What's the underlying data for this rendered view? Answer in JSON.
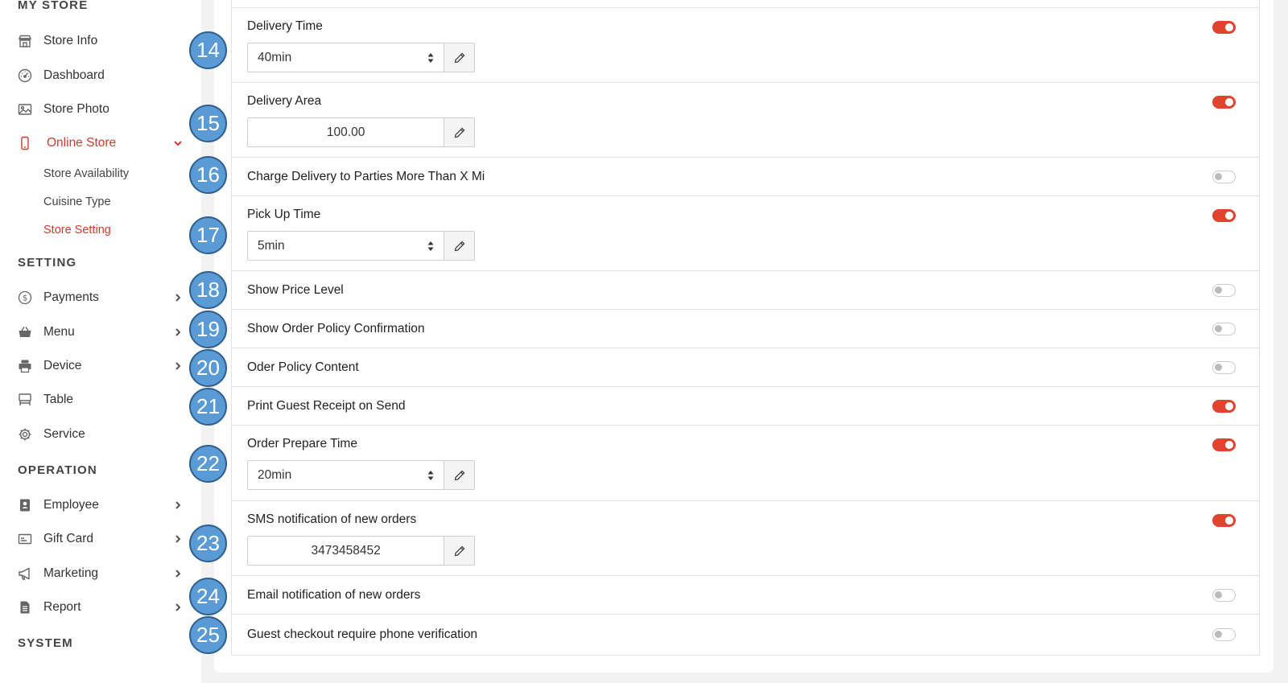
{
  "sidebar": {
    "sections": {
      "my_store": "MY STORE",
      "setting": "SETTING",
      "operation": "OPERATION",
      "system": "SYSTEM"
    },
    "items": {
      "store_info": "Store Info",
      "dashboard": "Dashboard",
      "store_photo": "Store Photo",
      "online_store": "Online Store",
      "payments": "Payments",
      "menu": "Menu",
      "device": "Device",
      "table": "Table",
      "service": "Service",
      "employee": "Employee",
      "gift_card": "Gift Card",
      "marketing": "Marketing",
      "report": "Report"
    },
    "sub_items": {
      "store_availability": "Store Availability",
      "cuisine_type": "Cuisine Type",
      "store_setting": "Store Setting"
    },
    "active_color": "#d33a2c"
  },
  "settings": {
    "delivery_time": {
      "label": "Delivery Time",
      "value": "40min",
      "enabled": true
    },
    "delivery_area": {
      "label": "Delivery Area",
      "value": "100.00",
      "enabled": true
    },
    "charge_delivery": {
      "label": "Charge Delivery to Parties More Than X Mi",
      "enabled": false
    },
    "pick_up_time": {
      "label": "Pick Up Time",
      "value": "5min",
      "enabled": true
    },
    "show_price_level": {
      "label": "Show Price Level",
      "enabled": false
    },
    "show_order_policy": {
      "label": "Show Order Policy Confirmation",
      "enabled": false
    },
    "order_policy_content": {
      "label": "Oder Policy Content",
      "enabled": false
    },
    "print_guest_receipt": {
      "label": "Print Guest Receipt on Send",
      "enabled": true
    },
    "order_prepare_time": {
      "label": "Order Prepare Time",
      "value": "20min",
      "enabled": true
    },
    "sms_notification": {
      "label": "SMS notification of new orders",
      "value": "3473458452",
      "enabled": true
    },
    "email_notification": {
      "label": "Email notification of new orders",
      "enabled": false
    },
    "guest_checkout_phone": {
      "label": "Guest checkout require phone verification",
      "enabled": false
    }
  },
  "badges": [
    "14",
    "15",
    "16",
    "17",
    "18",
    "19",
    "20",
    "21",
    "22",
    "23",
    "24",
    "25"
  ],
  "colors": {
    "toggle_on": "#e0442f",
    "badge_fill": "#5b9bd5",
    "badge_border": "#2e5f8f"
  }
}
